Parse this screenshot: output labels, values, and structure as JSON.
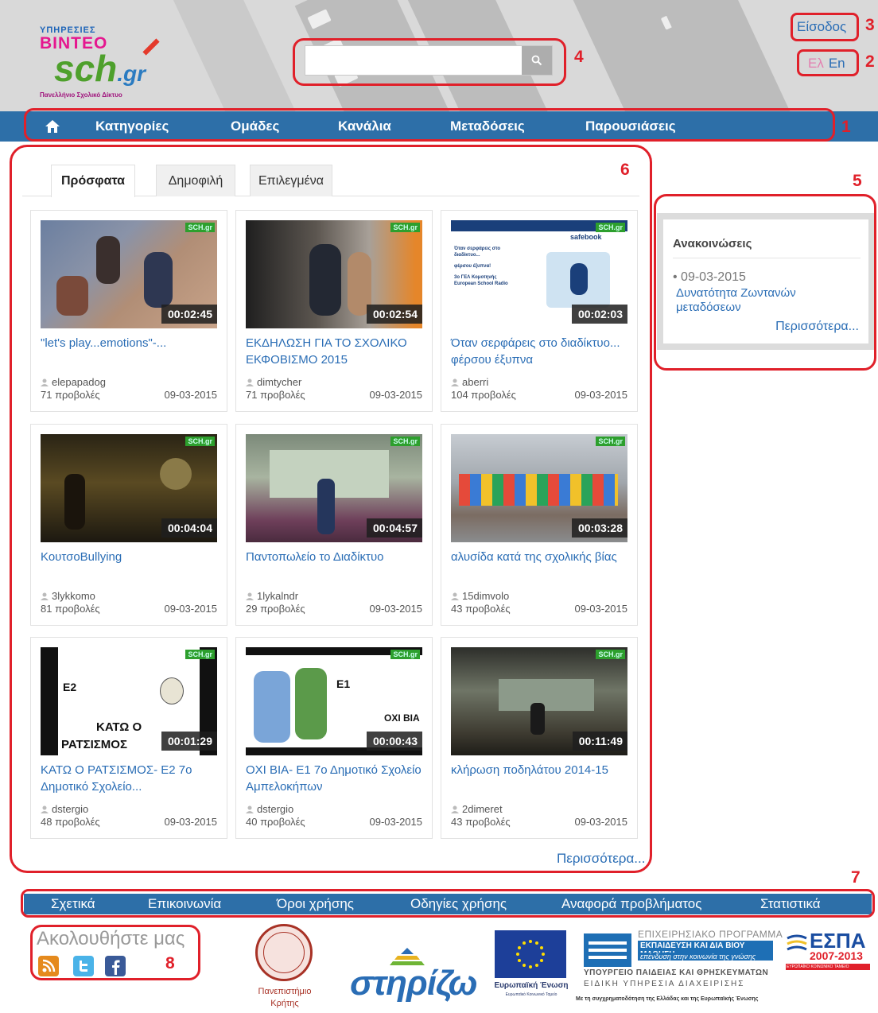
{
  "header": {
    "logo": {
      "line1": "ΥΠΗΡΕΣΙΕΣ",
      "line2": "ΒΙΝΤΕΟ",
      "line3": "sch",
      "line3b": ".gr",
      "tagline": "Πανελλήνιο Σχολικό Δίκτυο"
    },
    "search": {
      "placeholder": "",
      "value": "",
      "icon": "search-icon"
    },
    "login_label": "Είσοδος",
    "lang": {
      "el": "Ελ",
      "en": "En"
    }
  },
  "nav": {
    "home_icon": "home-icon",
    "items": [
      "Κατηγορίες",
      "Ομάδες",
      "Κανάλια",
      "Μεταδόσεις",
      "Παρουσιάσεις"
    ]
  },
  "tabs": [
    "Πρόσφατα",
    "Δημοφιλή",
    "Επιλεγμένα"
  ],
  "active_tab": "Πρόσφατα",
  "badge": "SCH.gr",
  "videos": [
    {
      "title": "\"let's play...emotions\"-...",
      "user": "elepapadog",
      "views": "71 προβολές",
      "date": "09-03-2015",
      "duration": "00:02:45"
    },
    {
      "title": "ΕΚΔΗΛΩΣΗ ΓΙΑ ΤΟ ΣΧΟΛΙΚΟ ΕΚΦΟΒΙΣΜΟ 2015",
      "user": "dimtycher",
      "views": "71 προβολές",
      "date": "09-03-2015",
      "duration": "00:02:54"
    },
    {
      "title": "Όταν σερφάρεις στο διαδίκτυο... φέρσου έξυπνα",
      "user": "aberri",
      "views": "104 προβολές",
      "date": "09-03-2015",
      "duration": "00:02:03"
    },
    {
      "title": "ΚουτσοBullying",
      "user": "3lykkomo",
      "views": "81 προβολές",
      "date": "09-03-2015",
      "duration": "00:04:04"
    },
    {
      "title": "Παντοπωλείο το Διαδίκτυο",
      "user": "1lykalndr",
      "views": "29 προβολές",
      "date": "09-03-2015",
      "duration": "00:04:57"
    },
    {
      "title": "αλυσίδα κατά της σχολικής βίας",
      "user": "15dimvolo",
      "views": "43 προβολές",
      "date": "09-03-2015",
      "duration": "00:03:28"
    },
    {
      "title": "ΚΑΤΩ Ο ΡΑΤΣΙΣΜΟΣ- Ε2 7ο Δημοτικό Σχολείο...",
      "user": "dstergio",
      "views": "48 προβολές",
      "date": "09-03-2015",
      "duration": "00:01:29"
    },
    {
      "title": "ΟΧΙ ΒΙΑ- Ε1 7ο Δημοτικό Σχολείο Αμπελοκήπων",
      "user": "dstergio",
      "views": "40 προβολές",
      "date": "09-03-2015",
      "duration": "00:00:43"
    },
    {
      "title": "κλήρωση ποδηλάτου 2014-15",
      "user": "2dimeret",
      "views": "43 προβολές",
      "date": "09-03-2015",
      "duration": "00:11:49"
    }
  ],
  "thumb_text": {
    "v3_lines": [
      "Όταν σερφάρεις στο διαδίκτυο...",
      "φέρσου έξυπνα!",
      "3ο ΓΕΛ Κομοτηνής European School Radio"
    ],
    "v3_brand": "safebook",
    "v7_e": "Ε2",
    "v7_main": [
      "ΚΑΤΩ Ο",
      "ΡΑΤΣΙΣΜΟΣ"
    ],
    "v8_e": "Ε1",
    "v8_main": "ΟΧΙ ΒΙΑ"
  },
  "more_label": "Περισσότερα...",
  "announcements": {
    "title": "Ανακοινώσεις",
    "date": "• 09-03-2015",
    "link": "Δυνατότητα Ζωντανών μεταδόσεων",
    "more": "Περισσότερα..."
  },
  "footer": {
    "links": [
      "Σχετικά",
      "Επικοινωνία",
      "Όροι χρήσης",
      "Οδηγίες χρήσης",
      "Αναφορά προβλήματος",
      "Στατιστικά"
    ],
    "follow_title": "Ακολουθήστε μας",
    "social": [
      "rss-icon",
      "twitter-icon",
      "facebook-icon"
    ],
    "university": [
      "Πανεπιστήμιο",
      "Κρήτης"
    ],
    "stirizo": "στηρίζω",
    "eu": {
      "label": "Ευρωπαϊκή Ένωση",
      "sub": "Ευρωπαϊκό Κοινωνικό Ταμείο"
    },
    "op": {
      "line1": "ΕΠΙΧΕΙΡΗΣΙΑΚΟ ΠΡΟΓΡΑΜΜΑ",
      "line2": "ΕΚΠΑΙΔΕΥΣΗ ΚΑΙ ΔΙΑ ΒΙΟΥ ΜΑΘΗΣΗ",
      "line3": "επένδυση στην κοινωνία της γνώσης",
      "line4": "ΥΠΟΥΡΓΕΙΟ ΠΑΙΔΕΙΑΣ ΚΑΙ ΘΡΗΣΚΕΥΜΑΤΩΝ",
      "line5": "ΕΙΔΙΚΗ ΥΠΗΡΕΣΙΑ ΔΙΑΧΕΙΡΙΣΗΣ",
      "line6": "Με τη συγχρηματοδότηση της Ελλάδας και της Ευρωπαϊκής Ένωσης"
    },
    "espa": {
      "title": "ΕΣΠΑ",
      "years": "2007-2013",
      "sub": "ΕΥΡΩΠΑΪΚΟ ΚΟΙΝΩΝΙΚΟ ΤΑΜΕΙΟ"
    }
  },
  "annotations": [
    "1",
    "2",
    "3",
    "4",
    "5",
    "6",
    "7",
    "8"
  ],
  "colors": {
    "nav_blue": "#2d6fa8",
    "link_blue": "#2a6db5",
    "annotation_red": "#e0202a"
  }
}
